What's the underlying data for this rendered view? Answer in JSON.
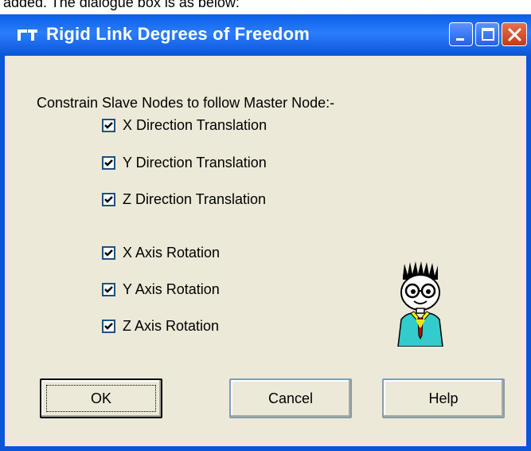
{
  "background_caption": "added. The dialogue box is as below:",
  "window": {
    "title": "Rigid Link Degrees of Freedom",
    "controls": [
      "minimize-icon",
      "maximize-icon",
      "close-icon"
    ]
  },
  "prompt": "Constrain Slave Nodes to follow Master Node:-",
  "checkboxes": [
    {
      "label": "X Direction Translation",
      "checked": true
    },
    {
      "label": "Y Direction Translation",
      "checked": true
    },
    {
      "label": "Z Direction Translation",
      "checked": true
    },
    {
      "label": "X Axis Rotation",
      "checked": true
    },
    {
      "label": "Y Axis Rotation",
      "checked": true
    },
    {
      "label": "Z Axis Rotation",
      "checked": true
    }
  ],
  "buttons": {
    "ok": "OK",
    "cancel": "Cancel",
    "help": "Help"
  },
  "colors": {
    "titlebar": "#0a5ee6",
    "dialog_bg": "#ece9d8",
    "close_button": "#c43b1a"
  }
}
